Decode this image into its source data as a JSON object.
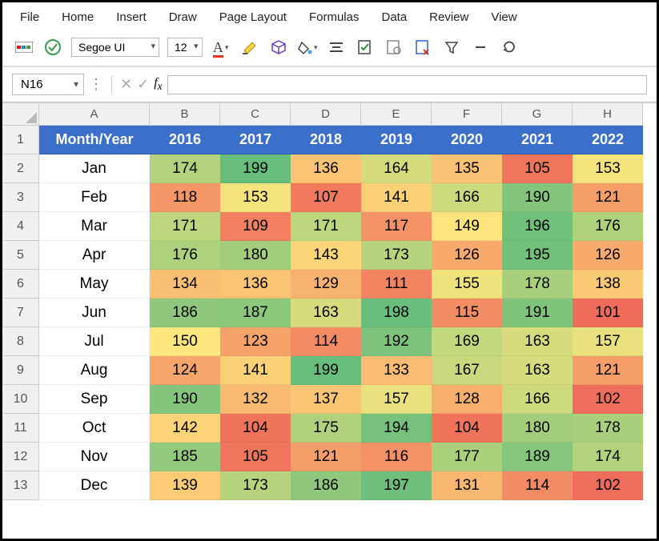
{
  "menu": [
    "File",
    "Home",
    "Insert",
    "Draw",
    "Page Layout",
    "Formulas",
    "Data",
    "Review",
    "View"
  ],
  "toolbar": {
    "font": "Segoe UI",
    "size": "12"
  },
  "namebox": "N16",
  "formula": "",
  "columns": [
    "A",
    "B",
    "C",
    "D",
    "E",
    "F",
    "G",
    "H"
  ],
  "header": {
    "label": "Month/Year",
    "years": [
      "2016",
      "2017",
      "2018",
      "2019",
      "2020",
      "2021",
      "2022"
    ]
  },
  "rows": [
    {
      "n": "1"
    },
    {
      "n": "2",
      "m": "Jan",
      "v": [
        174,
        199,
        136,
        164,
        135,
        105,
        153
      ]
    },
    {
      "n": "3",
      "m": "Feb",
      "v": [
        118,
        153,
        107,
        141,
        166,
        190,
        121
      ]
    },
    {
      "n": "4",
      "m": "Mar",
      "v": [
        171,
        109,
        171,
        117,
        149,
        196,
        176
      ]
    },
    {
      "n": "5",
      "m": "Apr",
      "v": [
        176,
        180,
        143,
        173,
        126,
        195,
        126
      ]
    },
    {
      "n": "6",
      "m": "May",
      "v": [
        134,
        136,
        129,
        111,
        155,
        178,
        138
      ]
    },
    {
      "n": "7",
      "m": "Jun",
      "v": [
        186,
        187,
        163,
        198,
        115,
        191,
        101
      ]
    },
    {
      "n": "8",
      "m": "Jul",
      "v": [
        150,
        123,
        114,
        192,
        169,
        163,
        157
      ]
    },
    {
      "n": "9",
      "m": "Aug",
      "v": [
        124,
        141,
        199,
        133,
        167,
        163,
        121
      ]
    },
    {
      "n": "10",
      "m": "Sep",
      "v": [
        190,
        132,
        137,
        157,
        128,
        166,
        102
      ]
    },
    {
      "n": "11",
      "m": "Oct",
      "v": [
        142,
        104,
        175,
        194,
        104,
        180,
        178
      ]
    },
    {
      "n": "12",
      "m": "Nov",
      "v": [
        185,
        105,
        121,
        116,
        177,
        189,
        174
      ]
    },
    {
      "n": "13",
      "m": "Dec",
      "v": [
        139,
        173,
        186,
        197,
        131,
        114,
        102
      ]
    }
  ],
  "chart_data": {
    "type": "heatmap",
    "title": "",
    "rows": [
      "Jan",
      "Feb",
      "Mar",
      "Apr",
      "May",
      "Jun",
      "Jul",
      "Aug",
      "Sep",
      "Oct",
      "Nov",
      "Dec"
    ],
    "columns": [
      "2016",
      "2017",
      "2018",
      "2019",
      "2020",
      "2021",
      "2022"
    ],
    "values": [
      [
        174,
        199,
        136,
        164,
        135,
        105,
        153
      ],
      [
        118,
        153,
        107,
        141,
        166,
        190,
        121
      ],
      [
        171,
        109,
        171,
        117,
        149,
        196,
        176
      ],
      [
        176,
        180,
        143,
        173,
        126,
        195,
        126
      ],
      [
        134,
        136,
        129,
        111,
        155,
        178,
        138
      ],
      [
        186,
        187,
        163,
        198,
        115,
        191,
        101
      ],
      [
        150,
        123,
        114,
        192,
        169,
        163,
        157
      ],
      [
        124,
        141,
        199,
        133,
        167,
        163,
        121
      ],
      [
        190,
        132,
        137,
        157,
        128,
        166,
        102
      ],
      [
        142,
        104,
        175,
        194,
        104,
        180,
        178
      ],
      [
        185,
        105,
        121,
        116,
        177,
        189,
        174
      ],
      [
        139,
        173,
        186,
        197,
        131,
        114,
        102
      ]
    ],
    "scale": {
      "min": 101,
      "max": 199,
      "low_color": "#ef6b5a",
      "mid_color": "#fee77e",
      "high_color": "#67bd7b"
    }
  }
}
